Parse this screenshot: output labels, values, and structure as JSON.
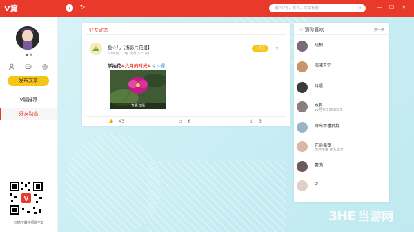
{
  "titlebar": {
    "logo": "V篇",
    "search_placeholder": "输入V号，昵称，文章标题",
    "back_icon": "chevron-left-icon",
    "refresh_icon": "refresh-icon",
    "min_icon": "minimize-icon",
    "max_icon": "maximize-icon",
    "close_icon": "close-icon"
  },
  "sidebar": {
    "username_mark": "▪  ∨",
    "publish_label": "发布文章",
    "menu": [
      {
        "label": "V篇推荐"
      },
      {
        "label": "好友动态"
      }
    ],
    "qr_caption": "扫描下载手机版V篇"
  },
  "feed": {
    "tab_label": "好友动态",
    "post": {
      "author": "鱼☆儿【携影片花组】",
      "time": "50天前",
      "views": "浏览(523次)",
      "follow_label": "+关注",
      "title_prefix": "学拍花",
      "title_highlight": "#六月的时光#",
      "location": "⚲ 火星",
      "image_caption": "查看详情",
      "likes": "43",
      "comments": "6",
      "shares": "3"
    }
  },
  "guess": {
    "title": "猜你喜欢",
    "switch_label": "换一换",
    "items": [
      {
        "name": "晓桐",
        "sub": ""
      },
      {
        "name": "海浦天空",
        "sub": ""
      },
      {
        "name": "诗语",
        "sub": ""
      },
      {
        "name": "水月",
        "sub": "vv号701501065"
      },
      {
        "name": "時光不懂矜持",
        "sub": ""
      },
      {
        "name": "花影摇曳",
        "sub": "你若不来  花为谁开"
      },
      {
        "name": "素肉",
        "sub": ""
      },
      {
        "name": "ღ",
        "sub": ""
      }
    ]
  },
  "watermark": {
    "logo": "3HE",
    "text": "当游网"
  }
}
